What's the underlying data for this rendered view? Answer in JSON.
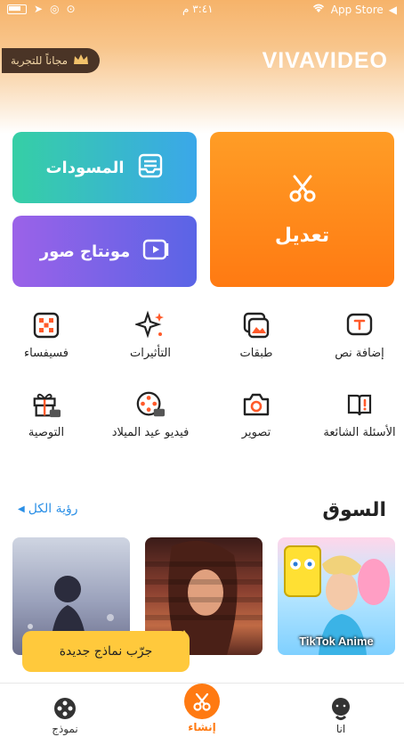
{
  "status_bar": {
    "time": "٣:٤١ م",
    "carrier": "App Store",
    "battery_percent": 70
  },
  "header": {
    "trial_label": "مجاناً للتجربة",
    "logo": "VIVAVIDEO"
  },
  "cards": {
    "drafts": "المسودات",
    "photo_montage": "مونتاج صور",
    "edit": "تعديل"
  },
  "tools": [
    {
      "label": "إضافة نص",
      "icon": "text-icon"
    },
    {
      "label": "طبقات",
      "icon": "layers-icon"
    },
    {
      "label": "التأثيرات",
      "icon": "sparkle-icon"
    },
    {
      "label": "فسيفساء",
      "icon": "mosaic-icon"
    },
    {
      "label": "الأسئلة الشائعة",
      "icon": "faq-icon"
    },
    {
      "label": "تصوير",
      "icon": "camera-icon"
    },
    {
      "label": "فيديو عيد الميلاد",
      "icon": "birthday-video-icon",
      "badge": "AD"
    },
    {
      "label": "التوصية",
      "icon": "gift-icon",
      "badge": "AD"
    }
  ],
  "market": {
    "title": "السوق",
    "see_all": "رؤية الكل",
    "thumbs": [
      {
        "caption": "TikTok Anime"
      }
    ]
  },
  "tooltip": "جرّب نماذج جديدة",
  "tabbar": {
    "me": "انا",
    "create": "إنشاء",
    "templates": "نموذج"
  },
  "colors": {
    "accent": "#ff7a12",
    "link": "#2a8fe6",
    "tooltip": "#ffc93c"
  }
}
